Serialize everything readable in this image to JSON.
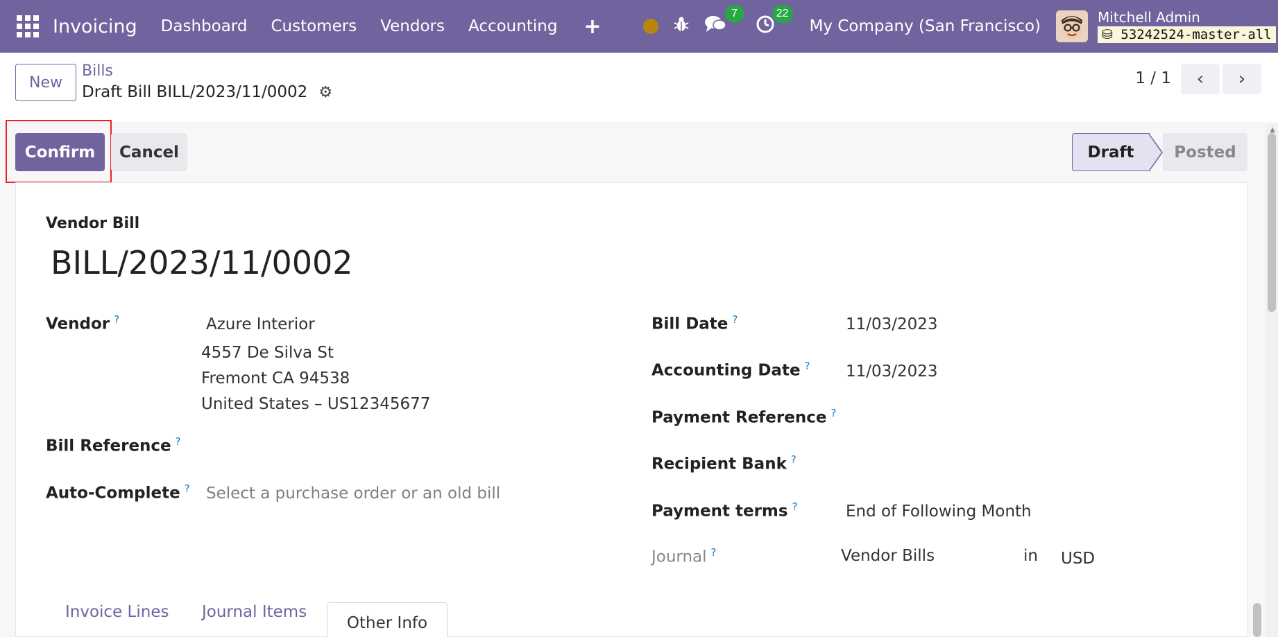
{
  "navbar": {
    "brand": "Invoicing",
    "menu": [
      "Dashboard",
      "Customers",
      "Vendors",
      "Accounting"
    ],
    "plus": "+",
    "messages_count": "7",
    "activities_count": "22",
    "company": "My Company (San Francisco)",
    "user_name": "Mitchell Admin",
    "db_name": "53242524-master-all",
    "colors": {
      "navbar": "#71639e",
      "badge": "#28a745"
    }
  },
  "control": {
    "new_label": "New",
    "breadcrumb": "Bills",
    "record_title": "Draft Bill BILL/2023/11/0002",
    "pager": "1 / 1"
  },
  "actions": {
    "confirm_label": "Confirm",
    "cancel_label": "Cancel"
  },
  "statusbar": {
    "draft": "Draft",
    "posted": "Posted"
  },
  "form": {
    "type_label": "Vendor Bill",
    "bill_number": "BILL/2023/11/0002",
    "vendor_label": "Vendor",
    "vendor_name": "Azure Interior",
    "vendor_address": [
      "4557 De Silva St",
      "Fremont CA 94538",
      "United States – US12345677"
    ],
    "bill_reference_label": "Bill Reference",
    "auto_complete_label": "Auto-Complete",
    "auto_complete_placeholder": "Select a purchase order or an old bill",
    "bill_date_label": "Bill Date",
    "bill_date": "11/03/2023",
    "accounting_date_label": "Accounting Date",
    "accounting_date": "11/03/2023",
    "payment_reference_label": "Payment Reference",
    "recipient_bank_label": "Recipient Bank",
    "payment_terms_label": "Payment terms",
    "payment_terms": "End of Following Month",
    "journal_label": "Journal",
    "journal": "Vendor Bills",
    "in_word": "in",
    "currency": "USD",
    "help_mark": "?"
  },
  "tabs": [
    "Invoice Lines",
    "Journal Items",
    "Other Info"
  ]
}
